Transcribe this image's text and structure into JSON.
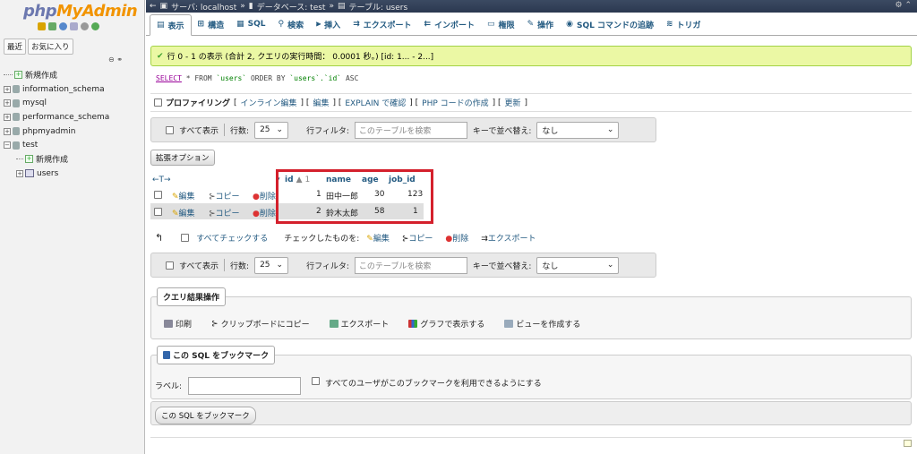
{
  "sidebar": {
    "logo_part1": "php",
    "logo_part2": "MyAdmin",
    "nav_tabs": [
      "最近",
      "お気に入り"
    ],
    "collapse": "⊖ ⚭",
    "tree": [
      {
        "label": "新規作成",
        "type": "new",
        "indent": 0
      },
      {
        "label": "information_schema",
        "type": "db",
        "indent": 0
      },
      {
        "label": "mysql",
        "type": "db",
        "indent": 0
      },
      {
        "label": "performance_schema",
        "type": "db",
        "indent": 0
      },
      {
        "label": "phpmyadmin",
        "type": "db",
        "indent": 0
      },
      {
        "label": "test",
        "type": "db-open",
        "indent": 0
      },
      {
        "label": "新規作成",
        "type": "new",
        "indent": 1
      },
      {
        "label": "users",
        "type": "table",
        "indent": 1
      }
    ]
  },
  "breadcrumb": {
    "server": "サーバ: localhost",
    "database": "データベース: test",
    "table": "テーブル: users"
  },
  "tabs": [
    "表示",
    "構造",
    "SQL",
    "検索",
    "挿入",
    "エクスポート",
    "インポート",
    "権限",
    "操作",
    "SQL コマンドの追跡",
    "トリガ"
  ],
  "success_message": "行 0 - 1 の表示 (合計 2, クエリの実行時間： 0.0001 秒。) [id: 1... - 2...]",
  "sql": {
    "select": "SELECT",
    "rest1": " * FROM ",
    "table": "`users`",
    "rest2": " ORDER BY ",
    "col": "`users`.`id`",
    "rest3": " ASC"
  },
  "profiling": {
    "label": "プロファイリング",
    "links": [
      "インライン編集",
      "編集",
      "EXPLAIN で確認",
      "PHP コードの作成",
      "更新"
    ]
  },
  "filter": {
    "show_all": "すべて表示",
    "rows_label": "行数:",
    "rows_value": "25",
    "filter_label": "行フィルタ:",
    "filter_placeholder": "このテーブルを検索",
    "sort_label": "キーで並べ替え:",
    "sort_value": "なし"
  },
  "options_button": "拡張オプション",
  "table": {
    "arrows": "←T→",
    "headers": [
      "id",
      "name",
      "age",
      "job_id"
    ],
    "sort_marker": "▲ 1",
    "actions": [
      "編集",
      "コピー",
      "削除"
    ],
    "rows": [
      {
        "id": "1",
        "name": "田中一郎",
        "age": "30",
        "job_id": "123"
      },
      {
        "id": "2",
        "name": "鈴木太郎",
        "age": "58",
        "job_id": "1"
      }
    ]
  },
  "bulk": {
    "check_all": "すべてチェックする",
    "with_selected": "チェックしたものを:",
    "actions": [
      "編集",
      "コピー",
      "削除",
      "エクスポート"
    ]
  },
  "query_ops": {
    "legend": "クエリ結果操作",
    "buttons": [
      "印刷",
      "クリップボードにコピー",
      "エクスポート",
      "グラフで表示する",
      "ビューを作成する"
    ]
  },
  "bookmark": {
    "legend": "この SQL をブックマーク",
    "label": "ラベル:",
    "share": "すべてのユーザがこのブックマークを利用できるようにする",
    "button": "この SQL をブックマーク"
  },
  "colors": {
    "accent": "#235a81",
    "highlight": "#d4202c",
    "success_bg": "#ebf8a4"
  }
}
